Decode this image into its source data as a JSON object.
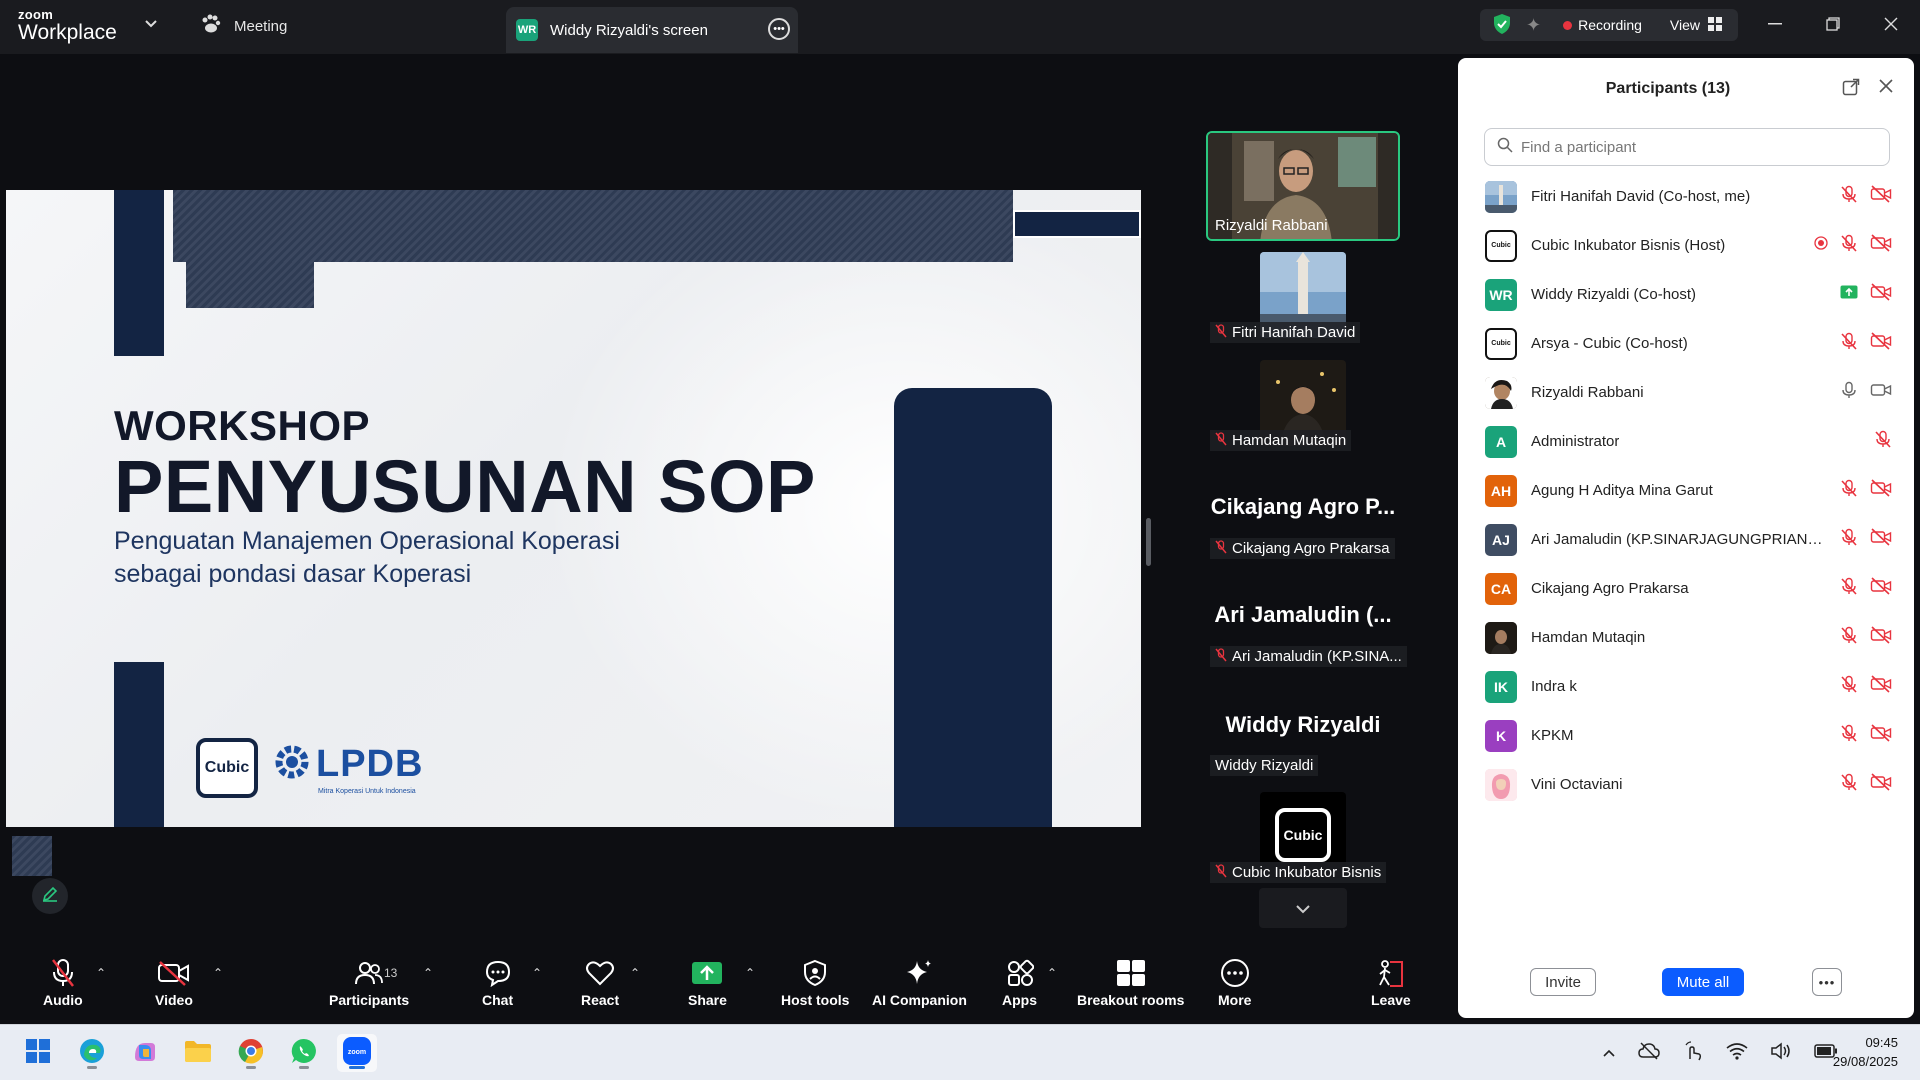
{
  "titlebar": {
    "brand_top": "zoom",
    "brand_bottom": "Workplace",
    "meeting_tab": "Meeting",
    "screen_tab_badge": "WR",
    "screen_tab_label": "Widdy Rizyaldi's screen",
    "recording_label": "Recording",
    "view_label": "View"
  },
  "slide": {
    "title_line1": "WORKSHOP",
    "title_line2": "PENYUSUNAN SOP",
    "subtitle_line1": "Penguatan Manajemen Operasional Koperasi",
    "subtitle_line2": "sebagai pondasi dasar Koperasi",
    "logo_cubic": "Cubic",
    "logo_lpdb": "LPDB",
    "logo_lpdb_tagline": "Mitra Koperasi Untuk Indonesia"
  },
  "gallery": {
    "tiles": [
      {
        "label": "Rizyaldi Rabbani"
      },
      {
        "label": "Fitri Hanifah David"
      },
      {
        "label": "Hamdan Mutaqin"
      },
      {
        "big": "Cikajang Agro P...",
        "label": "Cikajang Agro Prakarsa"
      },
      {
        "big": "Ari Jamaludin (...",
        "label": "Ari Jamaludin (KP.SINA..."
      },
      {
        "big": "Widdy Rizyaldi",
        "label": "Widdy Rizyaldi"
      },
      {
        "label": "Cubic Inkubator Bisnis",
        "logo": "Cubic"
      }
    ]
  },
  "panel": {
    "title": "Participants (13)",
    "search_placeholder": "Find a participant",
    "participants": [
      {
        "name": "Fitri Hanifah David (Co-host, me)",
        "initials": "",
        "color": "#6b8bb3"
      },
      {
        "name": "Cubic Inkubator Bisnis (Host)",
        "initials": "Cubic",
        "color": "#ffffff"
      },
      {
        "name": "Widdy Rizyaldi (Co-host)",
        "initials": "WR",
        "color": "#1aa37a"
      },
      {
        "name": "Arsya - Cubic (Co-host)",
        "initials": "Cubic",
        "color": "#ffffff"
      },
      {
        "name": "Rizyaldi Rabbani",
        "initials": "",
        "color": "#5a4a3a"
      },
      {
        "name": "Administrator",
        "initials": "A",
        "color": "#1aa37a"
      },
      {
        "name": "Agung H Aditya Mina Garut",
        "initials": "AH",
        "color": "#e2630a"
      },
      {
        "name": "Ari Jamaludin (KP.SINARJAGUNGPRIANG...",
        "initials": "AJ",
        "color": "#3f4d63"
      },
      {
        "name": "Cikajang Agro Prakarsa",
        "initials": "CA",
        "color": "#e2630a"
      },
      {
        "name": "Hamdan Mutaqin",
        "initials": "",
        "color": "#3a2f28"
      },
      {
        "name": "Indra k",
        "initials": "IK",
        "color": "#1aa37a"
      },
      {
        "name": "KPKM",
        "initials": "K",
        "color": "#9a3fc0"
      },
      {
        "name": "Vini Octaviani",
        "initials": "",
        "color": "#f0c7cf"
      }
    ],
    "invite_label": "Invite",
    "mute_all_label": "Mute all"
  },
  "toolbar": {
    "audio": "Audio",
    "video": "Video",
    "participants": "Participants",
    "participants_count": "13",
    "chat": "Chat",
    "react": "React",
    "share": "Share",
    "host_tools": "Host tools",
    "ai_companion": "AI Companion",
    "apps": "Apps",
    "breakout_rooms": "Breakout rooms",
    "more": "More",
    "leave": "Leave"
  },
  "taskbar": {
    "time": "09:45",
    "date": "29/08/2025"
  },
  "colors": {
    "accent_blue": "#0b5cff",
    "recording_red": "#e8343f",
    "active_speaker_green": "#2ac880",
    "slide_navy": "#132443"
  }
}
